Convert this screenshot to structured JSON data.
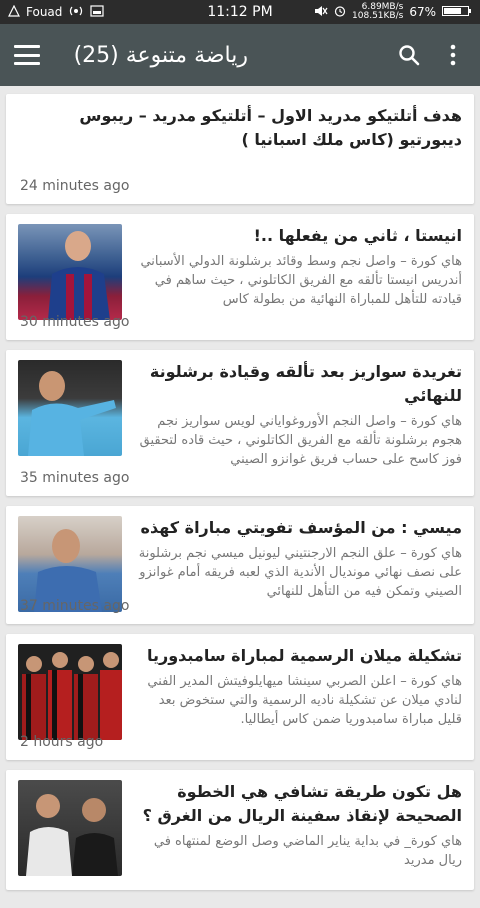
{
  "status_bar": {
    "carrier": "Fouad",
    "time": "11:12 PM",
    "net_speed_top": "6.89MB/s",
    "net_speed_bottom": "108.51KB/s",
    "battery": "67%"
  },
  "toolbar": {
    "title": "رياضة متنوعة (25)"
  },
  "articles": [
    {
      "headline": "هدف أتلتيكو مدريد الاول – أتلتيكو مدريد – ريبوس ديبورتيو (كاس ملك اسبانيا )",
      "snippet": "",
      "time": "24 minutes ago"
    },
    {
      "headline": "انيستا ، ثاني من يفعلها ..!",
      "snippet": "هاي كورة – واصل نجم وسط وقائد برشلونة الدولي الأسباني أندريس انيستا تألقه مع الفريق الكاتلوني ، حيث ساهم في قيادته للتأهل للمباراة النهائية من بطولة كاس",
      "time": "30 minutes ago"
    },
    {
      "headline": "تغريدة سواريز بعد تألقه وقيادة برشلونة للنهائي",
      "snippet": "هاي كورة – واصل النجم الأوروغواياني لويس سواريز نجم هجوم برشلونة تألقه مع الفريق الكاتلوني ، حيث قاده لتحقيق فوز كاسح على حساب فريق غوانزو الصيني",
      "time": "35 minutes ago"
    },
    {
      "headline": "ميسي : من المؤسف تفويتي مباراة كهذه",
      "snippet": "هاي كورة – علق النجم الارجنتيني ليونيل ميسي نجم برشلونة على نصف نهائي مونديال الأندية الذي لعبه فريقه أمام غوانزو الصيني وتمكن فيه من التأهل للنهائي",
      "time": "37 minutes ago"
    },
    {
      "headline": "تشكيلة ميلان الرسمية لمباراة سامبدوريا",
      "snippet": "هاي كورة – اعلن الصربي سينشا ميهايلوفيتش المدير الفني لنادي ميلان عن تشكيلة ناديه الرسمية والتي ستخوض بعد قليل مباراة سامبدوريا ضمن كاس أيطاليا.",
      "time": "2 hours ago"
    },
    {
      "headline": "هل تكون طريقة تشافي هي الخطوة الصحيحة لإنقاذ سفينة الريال من الغرق ؟",
      "snippet": "هاي كورة_ في بداية يناير الماضي وصل الوضع لمنتهاه في ريال مدريد",
      "time": ""
    }
  ],
  "colors": {
    "toolbar": "#4a5456",
    "status_bar": "#2c2c2c",
    "background": "#e9e9e9"
  }
}
